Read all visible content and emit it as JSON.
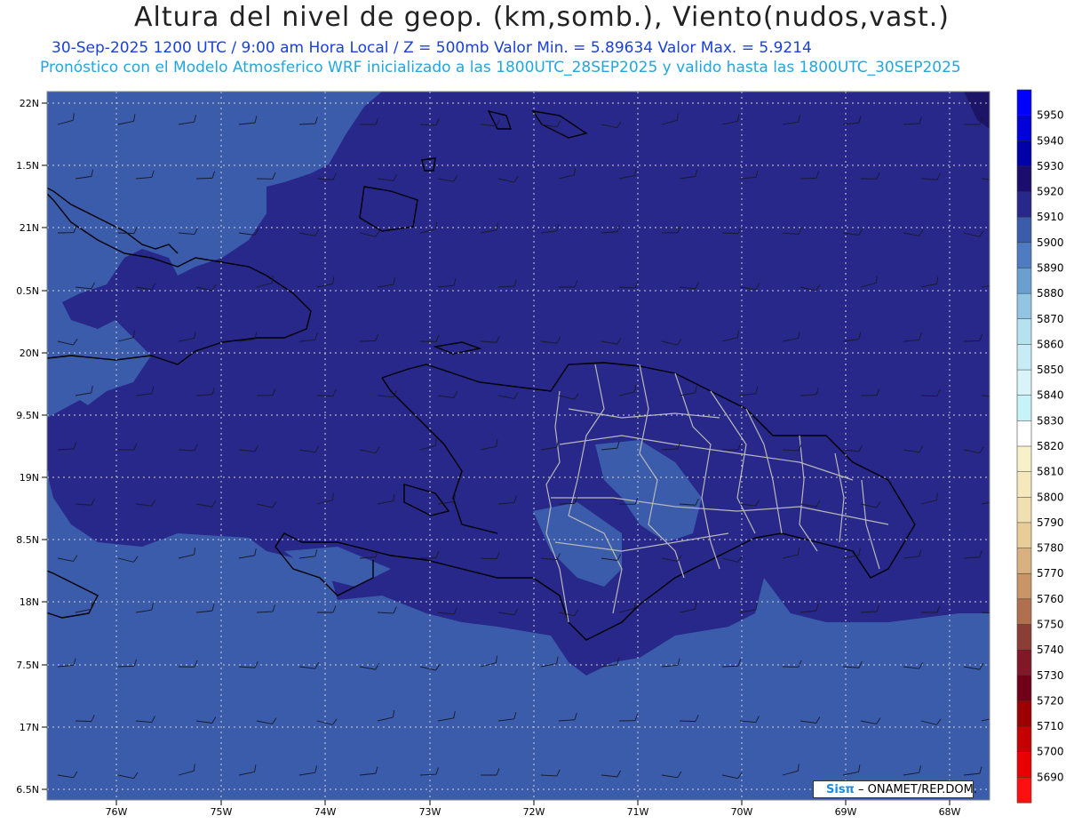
{
  "header": {
    "title": "Altura del nivel de geop. (km,somb.), Viento(nudos,vast.)",
    "subtitle": "30-Sep-2025  1200 UTC / 9:00 am Hora Local / Z = 500mb     Valor Min. = 5.89634  Valor Max. = 5.9214",
    "model_line": "Pronóstico con el Modelo Atmosferico WRF inicializado a las 1800UTC_28SEP2025 y valido hasta las  1800UTC_30SEP2025"
  },
  "map": {
    "lat_labels": [
      "22N",
      "1.5N",
      "21N",
      "0.5N",
      "20N",
      "9.5N",
      "19N",
      "8.5N",
      "18N",
      "7.5N",
      "17N",
      "6.5N"
    ],
    "lon_labels": [
      "76W",
      "75W",
      "74W",
      "73W",
      "72W",
      "71W",
      "70W",
      "69W",
      "68W"
    ],
    "colors": {
      "band_5900": "#3a5cab",
      "band_5910": "#28278a",
      "band_5920": "#1c1466",
      "band_5890": "#4f7cc0",
      "coast": "#000000",
      "border": "#b8b8b8"
    }
  },
  "colorbar": {
    "levels": [
      "5950",
      "5940",
      "5930",
      "5920",
      "5910",
      "5900",
      "5890",
      "5880",
      "5870",
      "5860",
      "5850",
      "5840",
      "5830",
      "5820",
      "5810",
      "5800",
      "5790",
      "5780",
      "5770",
      "5760",
      "5750",
      "5740",
      "5730",
      "5720",
      "5710",
      "5700",
      "5690"
    ],
    "colors": [
      "#0000ff",
      "#0000d8",
      "#0000a8",
      "#1a0d6e",
      "#28278a",
      "#3a5cab",
      "#4f7cc0",
      "#6a9fd0",
      "#92c4e4",
      "#b6e2f0",
      "#c8ecf5",
      "#daf3f8",
      "#c6f3f8",
      "#ffffff",
      "#f8f0c8",
      "#f5e8bc",
      "#f0dfb0",
      "#e8cd98",
      "#d9b080",
      "#c99566",
      "#b07050",
      "#8a3e36",
      "#801828",
      "#700018",
      "#9c0000",
      "#c40000",
      "#e80000",
      "#ff1010"
    ]
  },
  "credit": {
    "logo": "Sisπ",
    "text": "– ONAMET/REP.DOM."
  }
}
